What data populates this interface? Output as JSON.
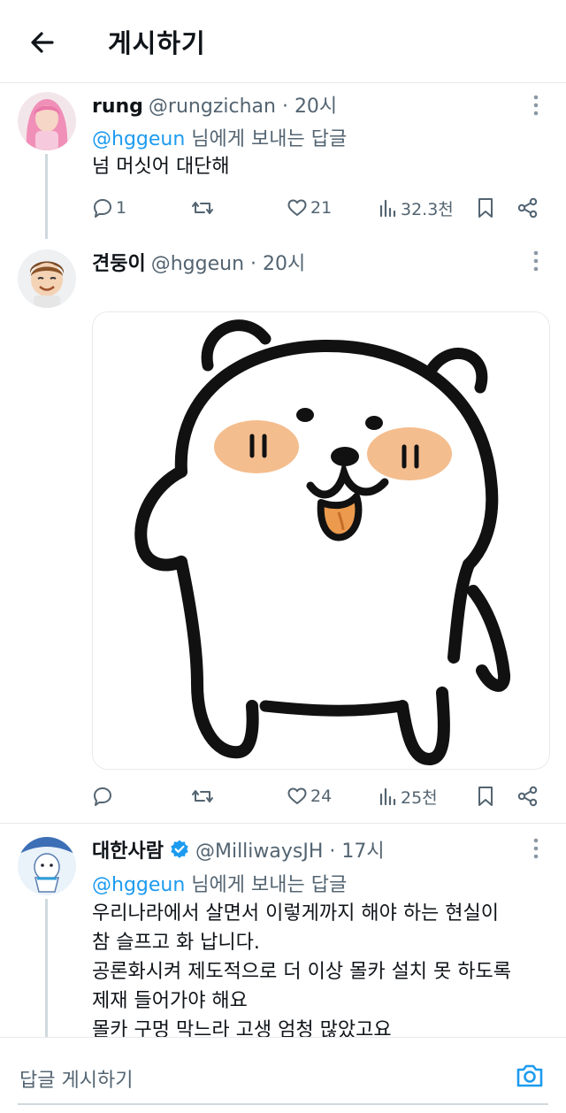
{
  "header": {
    "title": "게시하기",
    "back_icon": "arrow-left-icon"
  },
  "colors": {
    "accent": "#1d9bf0",
    "text": "#0f1419",
    "muted": "#536471",
    "verified": "#1d9bf0"
  },
  "tweets": [
    {
      "name": "rung",
      "handle": "@rungzichan",
      "time": "· 20시",
      "reply_mention": "@hggeun",
      "reply_suffix": " 님에게 보내는 답글",
      "lines": [
        "넘 머싯어 대단해"
      ],
      "stats": {
        "replies": "1",
        "retweets": "",
        "likes": "21",
        "views": "32.3천"
      }
    },
    {
      "name": "견둥이",
      "handle": "@hggeun",
      "time": "· 20시",
      "image_alt": "white bear character sticker",
      "stats": {
        "replies": "",
        "retweets": "",
        "likes": "24",
        "views": "25천"
      }
    },
    {
      "name": "대한사람",
      "handle": "@MilliwaysJH",
      "time": "· 17시",
      "reply_mention": "@hggeun",
      "reply_suffix": " 님에게 보내는 답글",
      "lines": [
        "우리나라에서 살면서 이렇게까지 해야 하는 현실이",
        "참 슬프고 화 납니다.",
        "공론화시켜 제도적으로 더 이상 몰카 설치 못 하도록",
        "제재 들어가야 해요",
        "몰카 구멍 막느라 고생 엄청 많았고요"
      ]
    }
  ],
  "composer": {
    "placeholder": "답글 게시하기",
    "icon": "camera-icon"
  }
}
